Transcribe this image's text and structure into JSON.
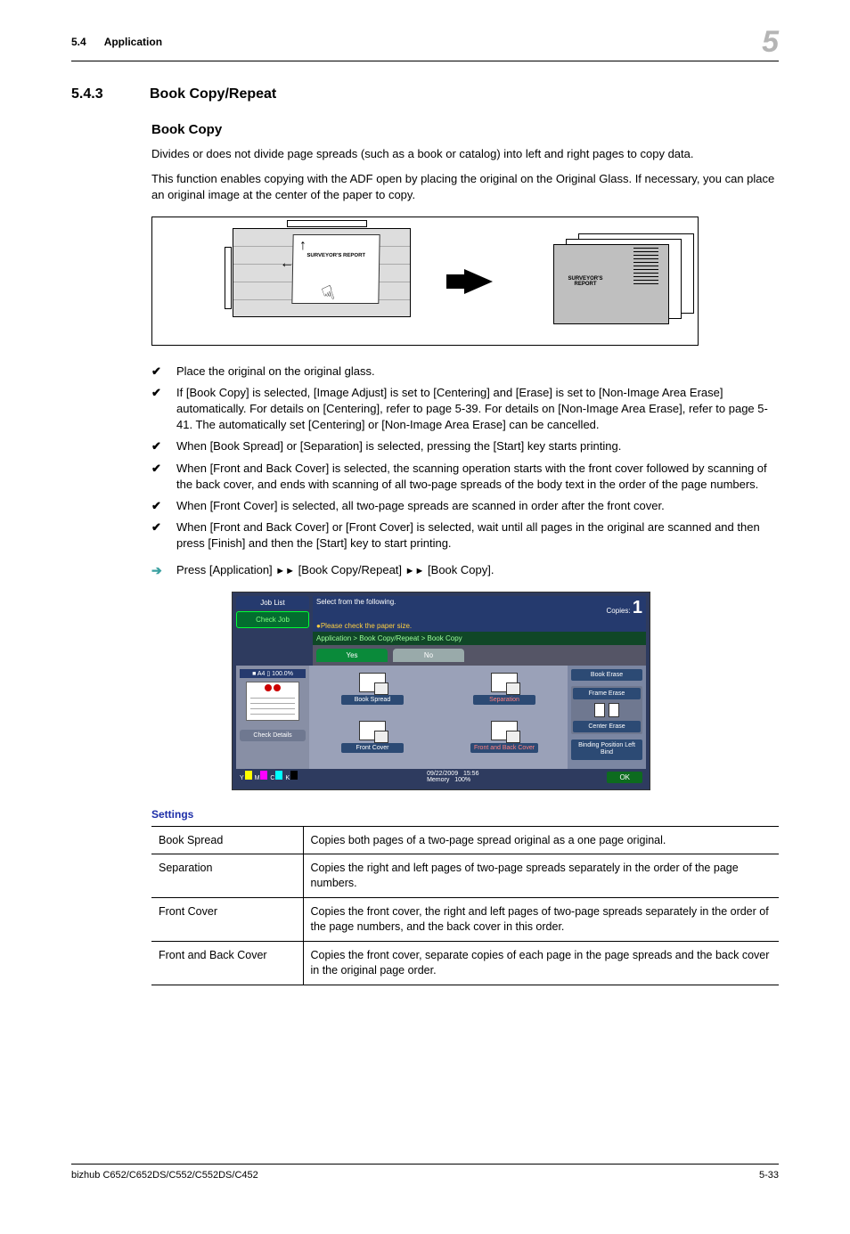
{
  "header": {
    "section_num": "5.4",
    "section_label": "Application",
    "chapter_num": "5"
  },
  "section": {
    "number": "5.4.3",
    "title": "Book Copy/Repeat"
  },
  "subsection": {
    "title": "Book Copy",
    "para1": "Divides or does not divide page spreads (such as a book or catalog) into left and right pages to copy data.",
    "para2": "This function enables copying with the ADF open by placing the original on the Original Glass. If necessary, you can place an original image at the center of the paper to copy."
  },
  "diagram": {
    "doc_label": "SURVEYOR'S REPORT",
    "output_label": "SURVEYOR'S REPORT"
  },
  "checks": {
    "c1": "Place the original on the original glass.",
    "c2": "If [Book Copy] is selected, [Image Adjust] is set to [Centering] and [Erase] is set to [Non-Image Area Erase] automatically. For details on [Centering], refer to page 5-39. For details on [Non-Image Area Erase], refer to page 5-41. The automatically set [Centering] or [Non-Image Area Erase] can be cancelled.",
    "c3": "When [Book Spread] or [Separation] is selected, pressing the [Start] key starts printing.",
    "c4": "When [Front and Back Cover] is selected, the scanning operation starts with the front cover followed by scanning of the back cover, and ends with scanning of all two-page spreads of the body text in the order of the page numbers.",
    "c5": "When [Front Cover] is selected, all two-page spreads are scanned in order after the front cover.",
    "c6": "When [Front and Back Cover] or [Front Cover] is selected, wait until all pages in the original are scanned and then press [Finish] and then the [Start] key to start printing."
  },
  "step": {
    "prefix": "Press [Application] ",
    "mid1": " [Book Copy/Repeat] ",
    "mid2": " [Book Copy]."
  },
  "ui": {
    "job_list": "Job List",
    "check_job": "Check Job",
    "select_text": "Select from the following.",
    "copies_label": "Copies:",
    "copies_value": "1",
    "warning": "Please check the paper size.",
    "breadcrumb": "Application > Book Copy/Repeat > Book Copy",
    "tab_yes": "Yes",
    "tab_no": "No",
    "paper_badge": "A4 ▯   100.0%",
    "check_details": "Check Details",
    "opt_book_spread": "Book Spread",
    "opt_separation": "Separation",
    "opt_front_cover": "Front Cover",
    "opt_front_back": "Front and Back Cover",
    "side_book_erase": "Book Erase",
    "side_frame_erase": "Frame Erase",
    "side_center_erase": "Center Erase",
    "side_binding": "Binding Position Left Bind",
    "date": "09/22/2009",
    "time": "15:56",
    "memory_label": "Memory",
    "memory_value": "100%",
    "ok": "OK",
    "toner_y": "Y",
    "toner_m": "M",
    "toner_c": "C",
    "toner_k": "K"
  },
  "settings": {
    "heading": "Settings",
    "rows": {
      "r1": {
        "name": "Book Spread",
        "desc": "Copies both pages of a two-page spread original as a one page original."
      },
      "r2": {
        "name": "Separation",
        "desc": "Copies the right and left pages of two-page spreads separately in the order of the page numbers."
      },
      "r3": {
        "name": "Front Cover",
        "desc": "Copies the front cover, the right and left pages of two-page spreads separately in the order of the page numbers, and the back cover in this order."
      },
      "r4": {
        "name": "Front and Back Cover",
        "desc": "Copies the front cover, separate copies of each page in the page spreads and the back cover in the original page order."
      }
    }
  },
  "footer": {
    "model": "bizhub C652/C652DS/C552/C552DS/C452",
    "page": "5-33"
  }
}
